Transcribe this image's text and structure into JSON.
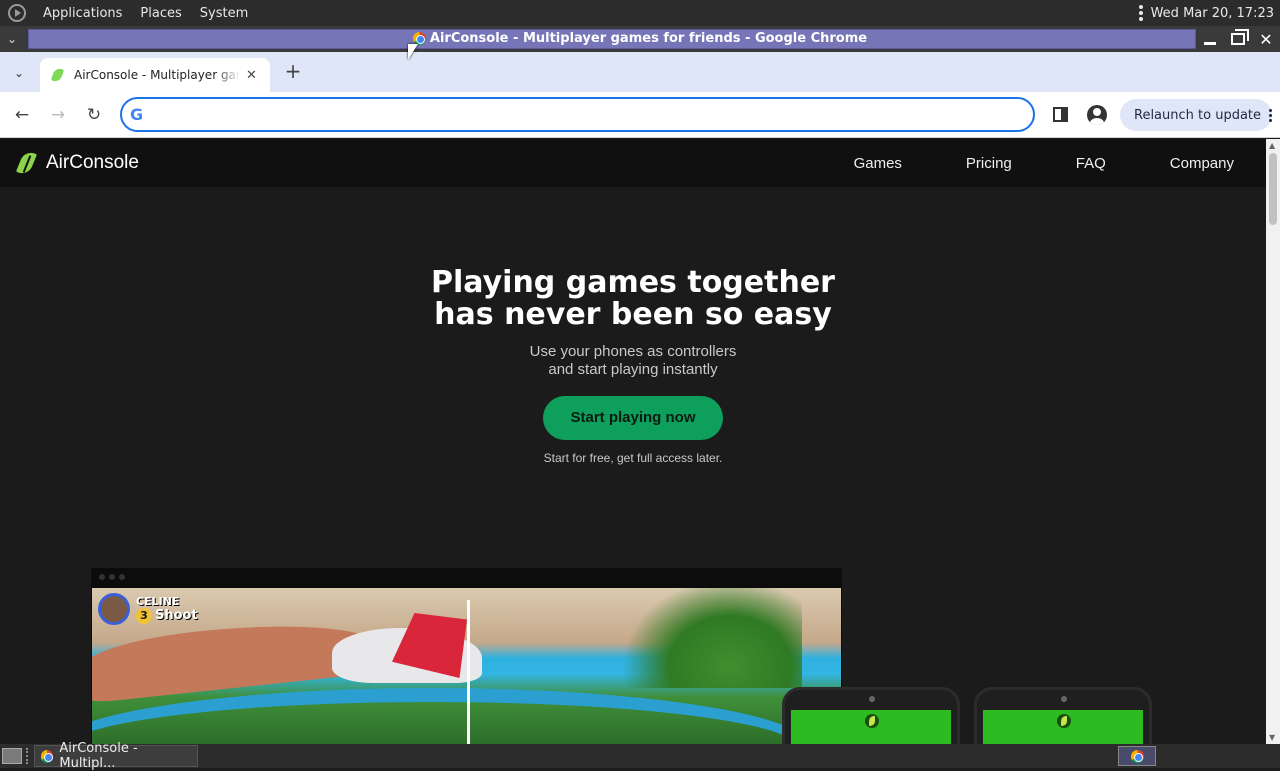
{
  "os_panel": {
    "menus": [
      "Applications",
      "Places",
      "System"
    ],
    "clock": "Wed Mar 20, 17:23"
  },
  "window": {
    "title": "AirConsole - Multiplayer games for friends - Google Chrome"
  },
  "browser": {
    "tab_title": "AirConsole - Multiplayer games for friends",
    "omnibox_value": "",
    "relaunch_label": "Relaunch to update"
  },
  "site": {
    "brand": "AirConsole",
    "nav": [
      "Games",
      "Pricing",
      "FAQ",
      "Company"
    ],
    "hero": {
      "title_line1": "Playing games together",
      "title_line2": "has never been so easy",
      "sub_line1": "Use your phones as controllers",
      "sub_line2": "and start playing instantly",
      "cta": "Start playing now",
      "cta_note": "Start for free, get full access later."
    },
    "game_hud": {
      "player_name": "CELINE",
      "shots": "3",
      "action": "Shoot"
    }
  },
  "taskbar": {
    "task_label": "AirConsole - Multipl..."
  }
}
